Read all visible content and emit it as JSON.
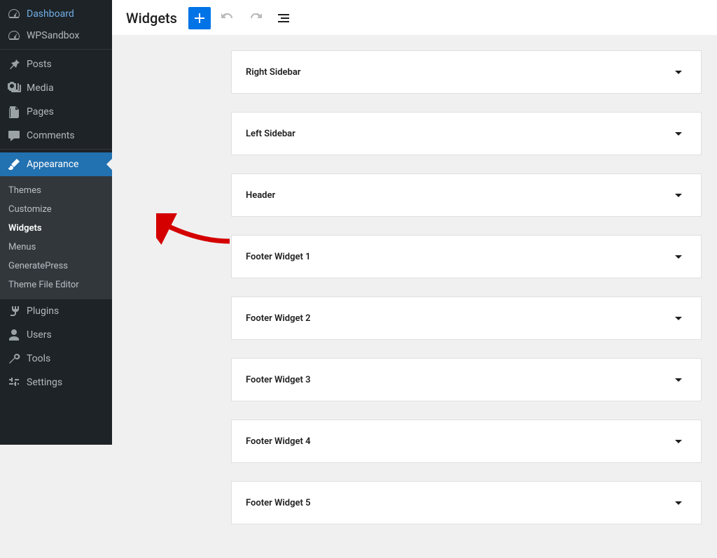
{
  "page_title": "Widgets",
  "sidebar": {
    "main_items": [
      {
        "id": "dashboard",
        "label": "Dashboard",
        "icon": "dashboard"
      },
      {
        "id": "wpsandbox",
        "label": "WPSandbox",
        "icon": "dashboard"
      },
      {
        "id": "posts",
        "label": "Posts",
        "icon": "pin"
      },
      {
        "id": "media",
        "label": "Media",
        "icon": "media"
      },
      {
        "id": "pages",
        "label": "Pages",
        "icon": "pages"
      },
      {
        "id": "comments",
        "label": "Comments",
        "icon": "comment"
      },
      {
        "id": "appearance",
        "label": "Appearance",
        "icon": "brush",
        "active": true
      },
      {
        "id": "plugins",
        "label": "Plugins",
        "icon": "plugin"
      },
      {
        "id": "users",
        "label": "Users",
        "icon": "user"
      },
      {
        "id": "tools",
        "label": "Tools",
        "icon": "wrench"
      },
      {
        "id": "settings",
        "label": "Settings",
        "icon": "sliders"
      }
    ],
    "appearance_submenu": [
      {
        "label": "Themes"
      },
      {
        "label": "Customize"
      },
      {
        "label": "Widgets",
        "current": true
      },
      {
        "label": "Menus"
      },
      {
        "label": "GeneratePress"
      },
      {
        "label": "Theme File Editor"
      }
    ]
  },
  "widget_areas": [
    {
      "title": "Right Sidebar"
    },
    {
      "title": "Left Sidebar"
    },
    {
      "title": "Header"
    },
    {
      "title": "Footer Widget 1"
    },
    {
      "title": "Footer Widget 2"
    },
    {
      "title": "Footer Widget 3"
    },
    {
      "title": "Footer Widget 4"
    },
    {
      "title": "Footer Widget 5"
    }
  ],
  "accent_color": "#2271b1",
  "add_button_color": "#0073e6"
}
